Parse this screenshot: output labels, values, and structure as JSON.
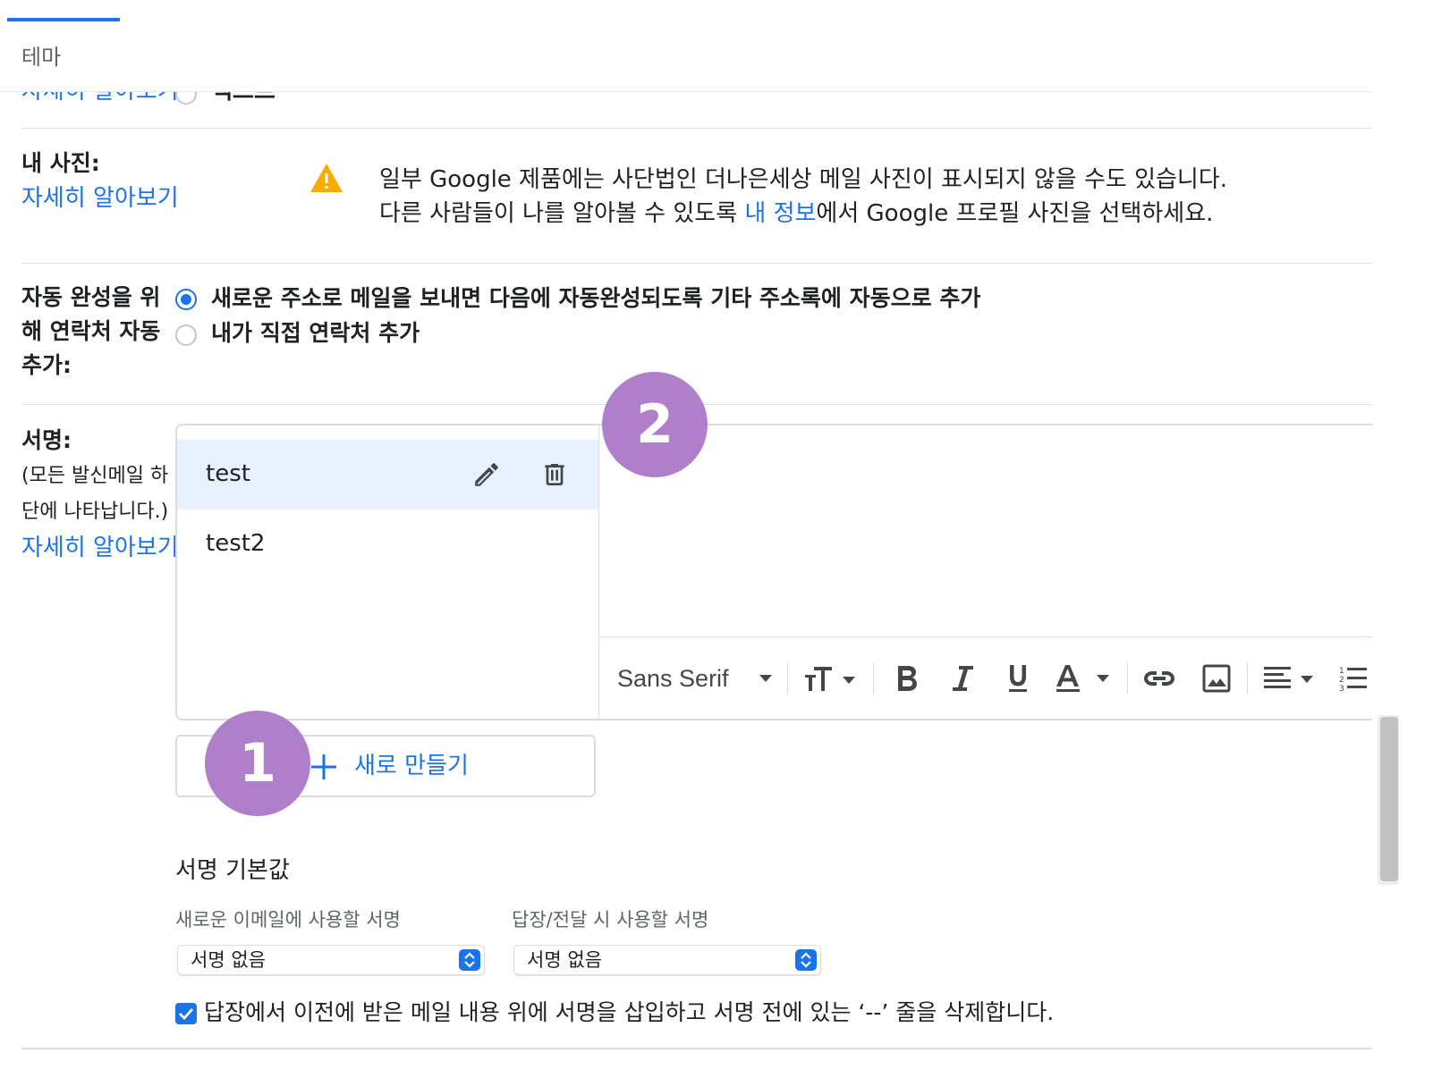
{
  "header": {
    "tab_label": "테마"
  },
  "clipped_row": {
    "link": "자세히 알아보기",
    "option": "텍스트"
  },
  "my_photo": {
    "label": "내 사진:",
    "learn_more": "자세히 알아보기",
    "warning_icon": "warning-icon",
    "line1": "일부 Google 제품에는 사단법인 더나은세상 메일 사진이 표시되지 않을 수도 있습니다.",
    "line2_before": "다른 사람들이 나를 알아볼 수 있도록 ",
    "line2_link": "내 정보",
    "line2_after": "에서 Google 프로필 사진을 선택하세요."
  },
  "autocomplete": {
    "label_line1": "자동 완성을 위",
    "label_line2": "해 연락처 자동",
    "label_line3": "추가:",
    "options": [
      {
        "label": "새로운 주소로 메일을 보내면 다음에 자동완성되도록 기타 주소록에 자동으로 추가",
        "checked": true
      },
      {
        "label": "내가 직접 연락처 추가",
        "checked": false
      }
    ]
  },
  "signature": {
    "label": "서명:",
    "note_line1": "(모든 발신메일 하",
    "note_line2": "단에 나타납니다.)",
    "learn_more": "자세히 알아보기",
    "items": [
      {
        "name": "test",
        "selected": true
      },
      {
        "name": "test2",
        "selected": false
      }
    ],
    "new_button": "새로 만들기",
    "toolbar": {
      "font": "Sans Serif",
      "icons": [
        "text-size-icon",
        "bold-icon",
        "italic-icon",
        "underline-icon",
        "text-color-icon",
        "link-icon",
        "image-icon",
        "align-icon",
        "numbered-list-icon"
      ]
    }
  },
  "callouts": {
    "one": "1",
    "two": "2"
  },
  "defaults": {
    "title": "서명 기본값",
    "new_email_label": "새로운 이메일에 사용할 서명",
    "new_email_value": "서명 없음",
    "reply_label": "답장/전달 시 사용할 서명",
    "reply_value": "서명 없음",
    "insert_before_quote": "답장에서 이전에 받은 메일 내용 위에 서명을 삽입하고 서명 전에 있는 ‘--’ 줄을 삭제합니다.",
    "insert_before_quote_checked": true
  },
  "colors": {
    "accent": "#1a73e8",
    "selected_row": "#e8f0fe",
    "callout": "#b07fcb",
    "warning": "#f9ab00"
  }
}
